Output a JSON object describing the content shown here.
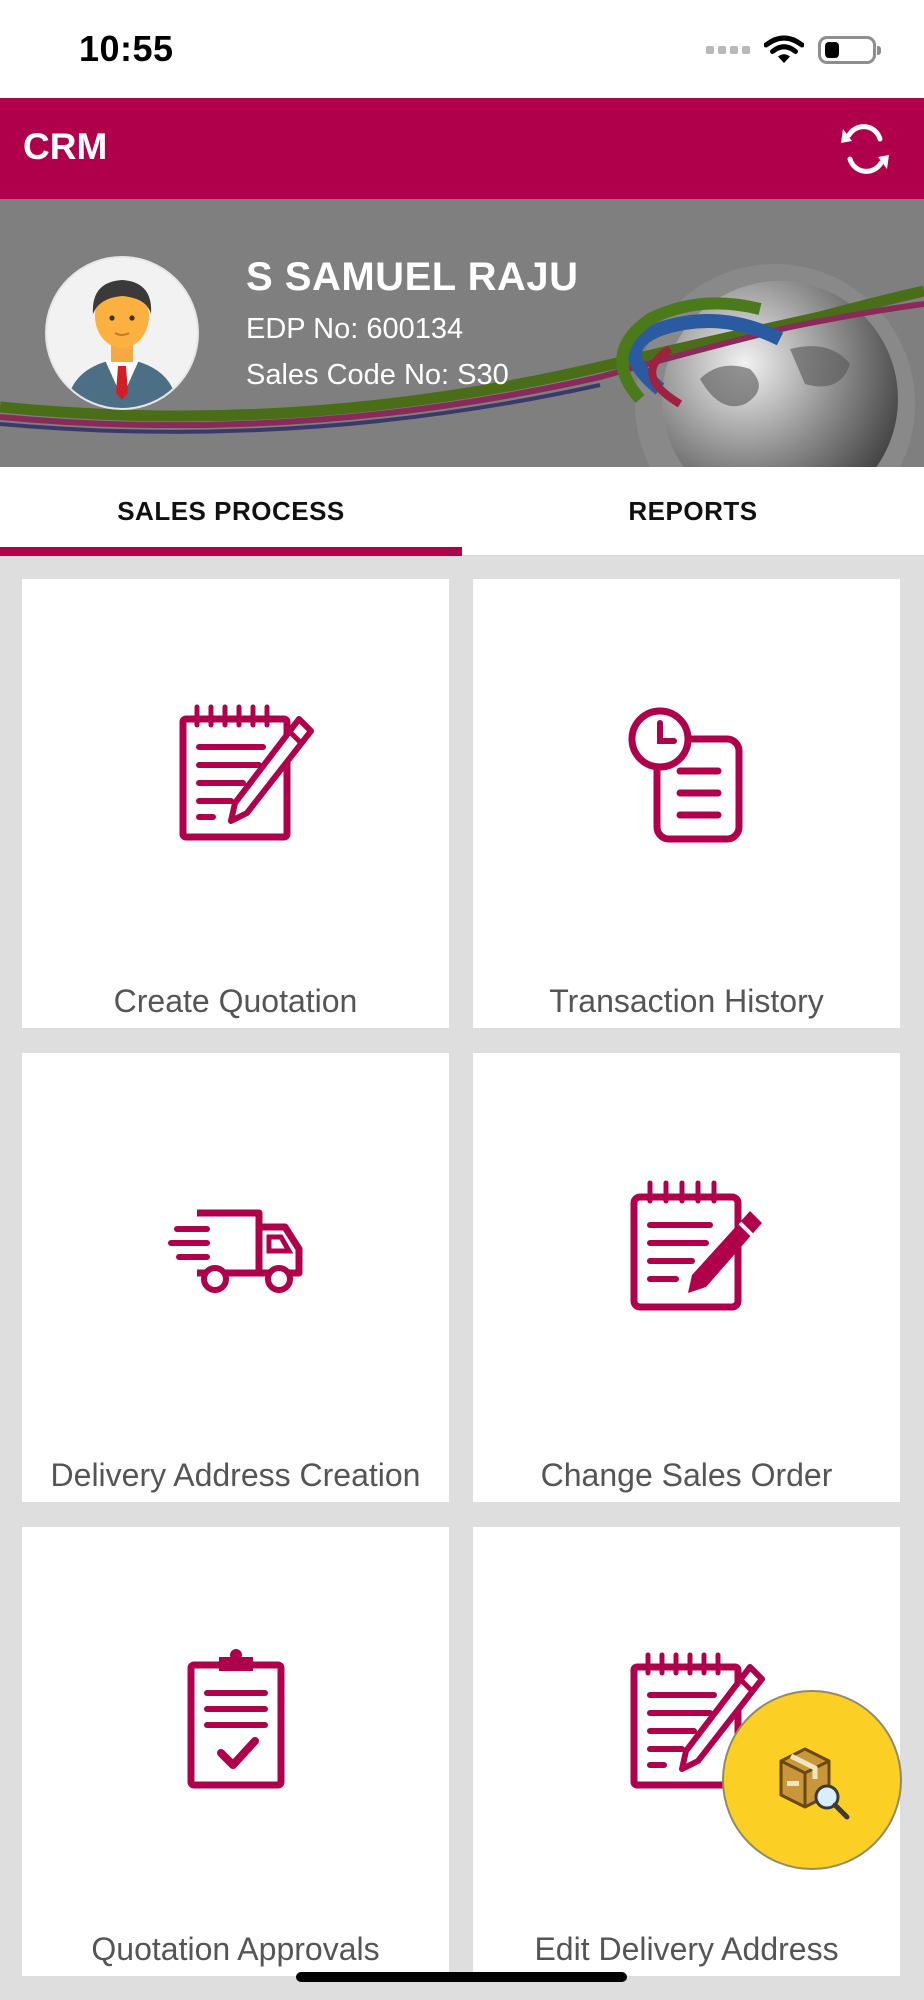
{
  "status_bar": {
    "time": "10:55",
    "battery_level_percent": 30,
    "icons": [
      "signal-dots-icon",
      "wifi-icon",
      "battery-icon"
    ]
  },
  "app_bar": {
    "title": "CRM",
    "refresh_icon": "refresh-icon",
    "color": "#b0004b"
  },
  "profile": {
    "name": "S SAMUEL RAJU",
    "edp": "EDP No: 600134",
    "sales_code": "Sales Code No: S30",
    "avatar_icon": "user-avatar-icon"
  },
  "tabs": [
    {
      "label": "SALES PROCESS",
      "active": true
    },
    {
      "label": "REPORTS",
      "active": false
    }
  ],
  "tiles": [
    {
      "label": "Create Quotation",
      "icon": "notepad-pencil-icon"
    },
    {
      "label": "Transaction History",
      "icon": "clock-document-icon"
    },
    {
      "label": "Delivery Address Creation",
      "icon": "delivery-truck-icon"
    },
    {
      "label": "Change Sales Order",
      "icon": "notepad-edit-icon"
    },
    {
      "label": "Quotation Approvals",
      "icon": "clipboard-check-icon"
    },
    {
      "label": "Edit Delivery Address",
      "icon": "notepad-pencil-icon"
    }
  ],
  "fab": {
    "icon": "package-search-icon",
    "color": "#fccf24"
  },
  "accent_color": "#b0004b"
}
